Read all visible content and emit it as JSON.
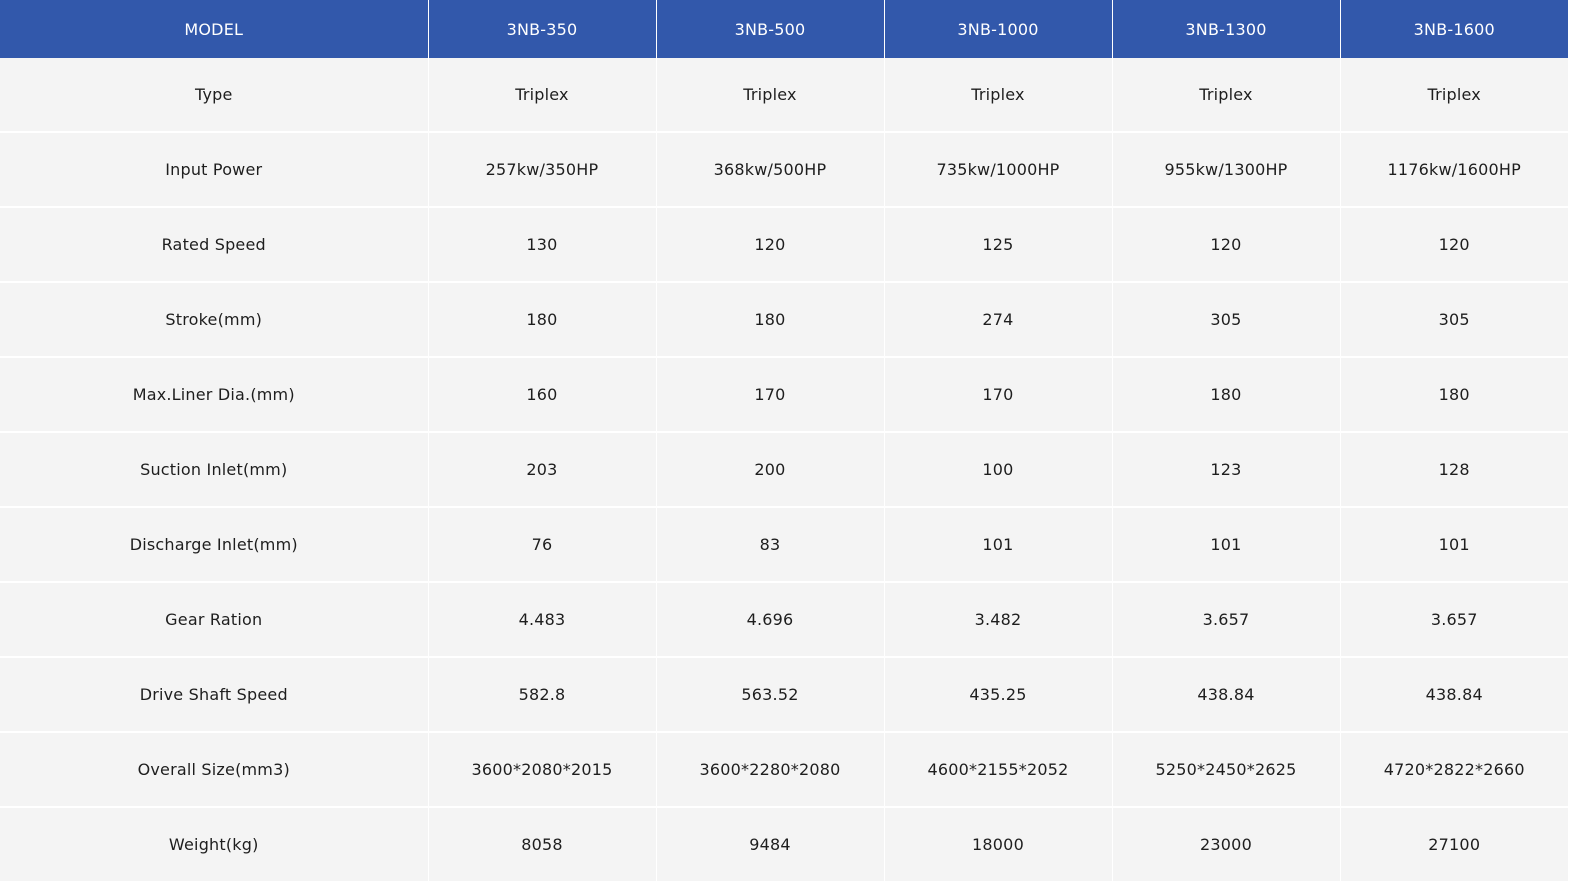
{
  "table": {
    "header": [
      "MODEL",
      "3NB-350",
      "3NB-500",
      "3NB-1000",
      "3NB-1300",
      "3NB-1600"
    ],
    "rows": [
      [
        "Type",
        "Triplex",
        "Triplex",
        "Triplex",
        "Triplex",
        "Triplex"
      ],
      [
        "Input Power",
        "257kw/350HP",
        "368kw/500HP",
        "735kw/1000HP",
        "955kw/1300HP",
        "1176kw/1600HP"
      ],
      [
        "Rated Speed",
        "130",
        "120",
        "125",
        "120",
        "120"
      ],
      [
        "Stroke(mm)",
        "180",
        "180",
        "274",
        "305",
        "305"
      ],
      [
        "Max.Liner Dia.(mm)",
        "160",
        "170",
        "170",
        "180",
        "180"
      ],
      [
        "Suction Inlet(mm)",
        "203",
        "200",
        "100",
        "123",
        "128"
      ],
      [
        "Discharge Inlet(mm)",
        "76",
        "83",
        "101",
        "101",
        "101"
      ],
      [
        "Gear Ration",
        "4.483",
        "4.696",
        "3.482",
        "3.657",
        "3.657"
      ],
      [
        "Drive Shaft Speed",
        "582.8",
        "563.52",
        "435.25",
        "438.84",
        "438.84"
      ],
      [
        "Overall Size(mm3)",
        "3600*2080*2015",
        "3600*2280*2080",
        "4600*2155*2052",
        "5250*2450*2625",
        "4720*2822*2660"
      ],
      [
        "Weight(kg)",
        "8058",
        "9484",
        "18000",
        "23000",
        "27100"
      ]
    ]
  },
  "colors": {
    "header_bg": "#3258ab",
    "header_text": "#ffffff",
    "cell_bg": "#f4f4f4",
    "cell_text": "#1e1e1e",
    "grid": "#ffffff"
  }
}
